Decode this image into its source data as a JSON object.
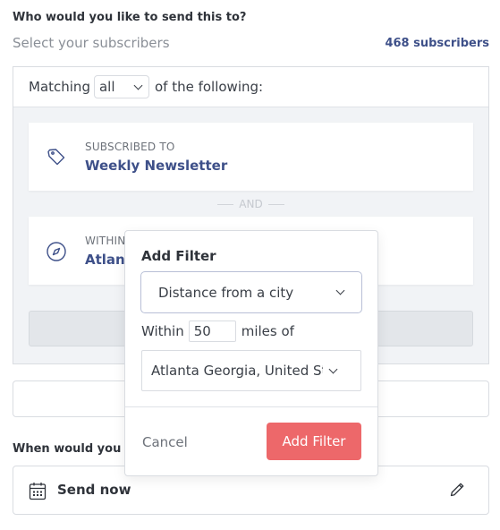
{
  "recipients": {
    "question": "Who would you like to send this to?",
    "subtitle": "Select your subscribers",
    "count": "468 subscribers"
  },
  "filter": {
    "matching_prefix": "Matching",
    "matching_value": "all",
    "matching_suffix": "of the following:",
    "rules": [
      {
        "kicker": "SUBSCRIBED TO",
        "value": "Weekly Newsletter",
        "icon": "tag-icon"
      },
      {
        "kicker": "WITHIN",
        "value": "Atlanta",
        "icon": "compass-icon"
      }
    ],
    "separator": "AND"
  },
  "popover": {
    "title": "Add Filter",
    "filter_type": "Distance from a city",
    "within_label": "Within",
    "miles_value": "50",
    "miles_suffix": "miles of",
    "city_value": "Atlanta Georgia, United States",
    "cancel_label": "Cancel",
    "submit_label": "Add Filter"
  },
  "schedule": {
    "question": "When would you like to send this?",
    "option": "Send now"
  },
  "colors": {
    "accent": "#3e5089",
    "primary_button": "#ed686a"
  }
}
